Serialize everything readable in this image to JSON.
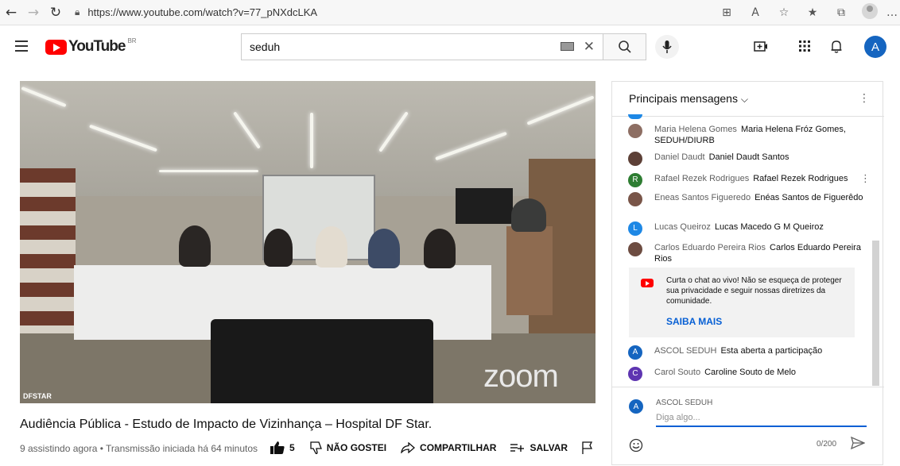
{
  "browser": {
    "url": "https://www.youtube.com/watch?v=77_pNXdcLKA",
    "nav_icons": [
      "back-icon",
      "forward-icon",
      "reload-icon"
    ],
    "toolbar_icons": [
      "apps-icon",
      "read-aloud-icon",
      "favorite-add-icon",
      "favorites-icon",
      "collections-icon",
      "profile-icon",
      "more-icon"
    ]
  },
  "youtube": {
    "logo_text": "YouTube",
    "country_code": "BR",
    "search_value": "seduh",
    "account_initial": "A"
  },
  "video": {
    "title": "Audiência Pública - Estudo de Impacto de Vizinhança – Hospital DF Star.",
    "meta": "9 assistindo agora • Transmissão iniciada há 64 minutos",
    "watermark_zoom": "zoom",
    "watermark_channel": "DFSTAR",
    "actions": {
      "likes": "5",
      "dislike_label": "NÃO GOSTEI",
      "share_label": "COMPARTILHAR",
      "save_label": "SALVAR"
    }
  },
  "chat": {
    "header": "Principais mensagens",
    "messages": [
      {
        "author": "Maria Helena Gomes",
        "text": "Maria Helena Fróz Gomes, SEDUH/DIURB",
        "avatar_color": "#8d6e63"
      },
      {
        "author": "Daniel Daudt",
        "text": "Daniel Daudt Santos",
        "avatar_color": "#5d4037"
      },
      {
        "author": "Rafael Rezek Rodrigues",
        "text": "Rafael Rezek Rodrigues",
        "avatar_color": "#2e7d32",
        "initial": "R"
      },
      {
        "author": "Eneas Santos Figueredo",
        "text": "Enéas Santos de Figuerêdo",
        "avatar_color": "#795548"
      },
      {
        "author": "Lucas Queiroz",
        "text": "Lucas Macedo G M Queiroz",
        "avatar_color": "#1e88e5",
        "initial": "L"
      },
      {
        "author": "Carlos Eduardo Pereira Rios",
        "text": "Carlos Eduardo Pereira Rios",
        "avatar_color": "#6d4c41"
      },
      {
        "author": "ASCOL SEDUH",
        "text": "Esta aberta a participação",
        "avatar_color": "#1565c0",
        "initial": "A"
      },
      {
        "author": "Carol Souto",
        "text": "Caroline Souto de Melo",
        "avatar_color": "#5e35b1",
        "initial": "C"
      }
    ],
    "notice": {
      "text": "Curta o chat ao vivo! Não se esqueça de proteger sua privacidade e seguir nossas diretrizes da comunidade.",
      "link": "SAIBA MAIS"
    },
    "compose": {
      "author": "ASCOL SEDUH",
      "initial": "A",
      "placeholder": "Diga algo...",
      "counter": "0/200"
    }
  }
}
